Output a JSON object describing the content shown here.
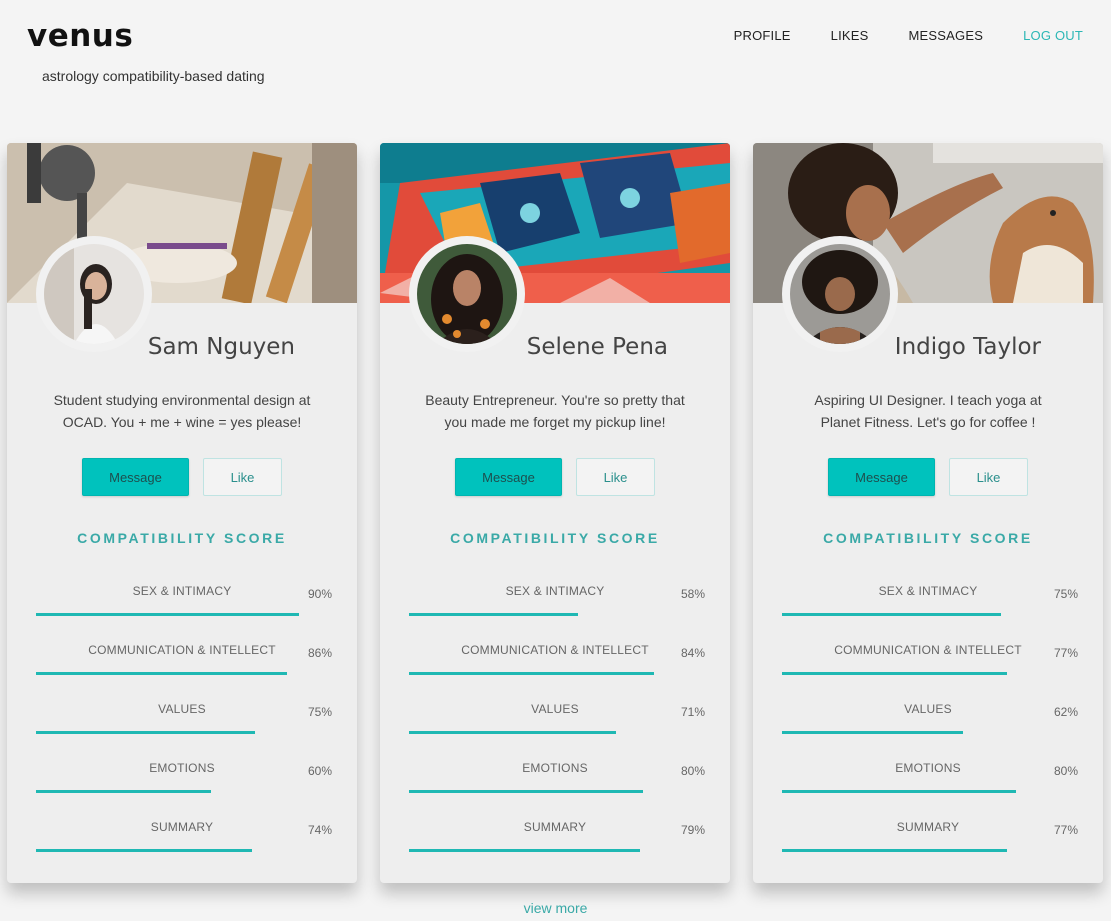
{
  "header": {
    "brand": "venus",
    "tagline": "astrology compatibility-based dating",
    "nav": [
      "PROFILE",
      "LIKES",
      "MESSAGES",
      "LOG OUT"
    ],
    "accent_color": "#2cb7b5"
  },
  "compat_heading": "COMPATIBILITY SCORE",
  "buttons": {
    "message": "Message",
    "like": "Like"
  },
  "profiles": [
    {
      "name": "Sam Nguyen",
      "bio": "Student studying environmental design at OCAD. You + me + wine = yes please!",
      "cover_icon": "studio-photo",
      "avatar_icon": "profile-photo",
      "metrics": [
        {
          "label": "SEX & INTIMACY",
          "pct": "90%",
          "value": 0.9
        },
        {
          "label": "COMMUNICATION & INTELLECT",
          "pct": "86%",
          "value": 0.86
        },
        {
          "label": "VALUES",
          "pct": "75%",
          "value": 0.75
        },
        {
          "label": "EMOTIONS",
          "pct": "60%",
          "value": 0.6
        },
        {
          "label": "SUMMARY",
          "pct": "74%",
          "value": 0.74
        }
      ]
    },
    {
      "name": "Selene Pena",
      "bio": "Beauty Entrepreneur. You're so pretty that you made me forget my pickup line!",
      "cover_icon": "mural-photo",
      "avatar_icon": "profile-photo",
      "metrics": [
        {
          "label": "SEX & INTIMACY",
          "pct": "58%",
          "value": 0.58
        },
        {
          "label": "COMMUNICATION & INTELLECT",
          "pct": "84%",
          "value": 0.84
        },
        {
          "label": "VALUES",
          "pct": "71%",
          "value": 0.71
        },
        {
          "label": "EMOTIONS",
          "pct": "80%",
          "value": 0.8
        },
        {
          "label": "SUMMARY",
          "pct": "79%",
          "value": 0.79
        }
      ]
    },
    {
      "name": "Indigo Taylor",
      "bio": "Aspiring UI Designer. I teach yoga at Planet Fitness. Let's go for coffee !",
      "cover_icon": "dog-photo",
      "avatar_icon": "profile-photo",
      "metrics": [
        {
          "label": "SEX & INTIMACY",
          "pct": "75%",
          "value": 0.75
        },
        {
          "label": "COMMUNICATION & INTELLECT",
          "pct": "77%",
          "value": 0.77
        },
        {
          "label": "VALUES",
          "pct": "62%",
          "value": 0.62
        },
        {
          "label": "EMOTIONS",
          "pct": "80%",
          "value": 0.8
        },
        {
          "label": "SUMMARY",
          "pct": "77%",
          "value": 0.77
        }
      ]
    }
  ],
  "view_more": "view more"
}
